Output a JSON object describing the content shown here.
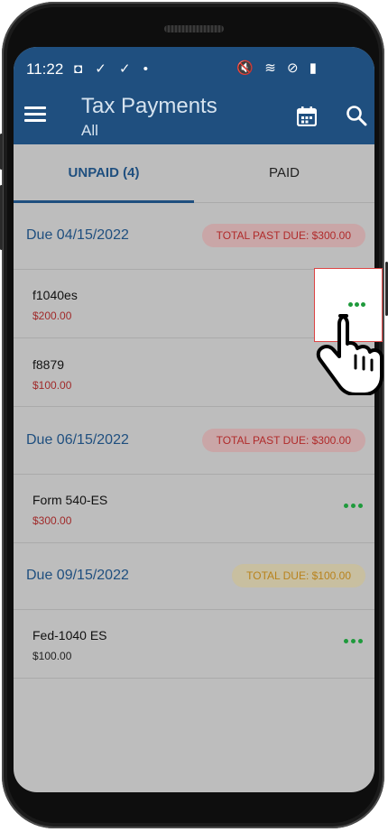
{
  "status_bar": {
    "time": "11:22",
    "left_icons": "◘ ✓ ✓ •",
    "right_icons": "🔇 ≋ ⊘ ▮"
  },
  "app_bar": {
    "title": "Tax Payments",
    "subtitle": "All",
    "icons": [
      "menu-icon",
      "calendar-icon",
      "search-icon"
    ]
  },
  "tabs": [
    {
      "label": "UNPAID (4)",
      "active": true
    },
    {
      "label": "PAID",
      "active": false
    }
  ],
  "groups": [
    {
      "date": "Due 04/15/2022",
      "badge": "TOTAL PAST DUE: $300.00",
      "items": [
        {
          "name": "f1040es",
          "amount": "$200.00"
        },
        {
          "name": "f8879",
          "amount": "$100.00"
        }
      ]
    },
    {
      "date": "Due 06/15/2022",
      "badge": "TOTAL PAST DUE: $300.00",
      "items": [
        {
          "name": "Form 540-ES",
          "amount": "$300.00"
        }
      ]
    },
    {
      "date": "Due 09/15/2022",
      "badge": "TOTAL DUE: $100.00",
      "items": [
        {
          "name": "Fed-1040 ES",
          "amount": "$100.00"
        }
      ]
    }
  ],
  "colors": {
    "primary": "#1f4f7f",
    "past_due_text": "#b02a2a",
    "due_text": "#b8821c",
    "more_dots": "#1f9a3c"
  }
}
